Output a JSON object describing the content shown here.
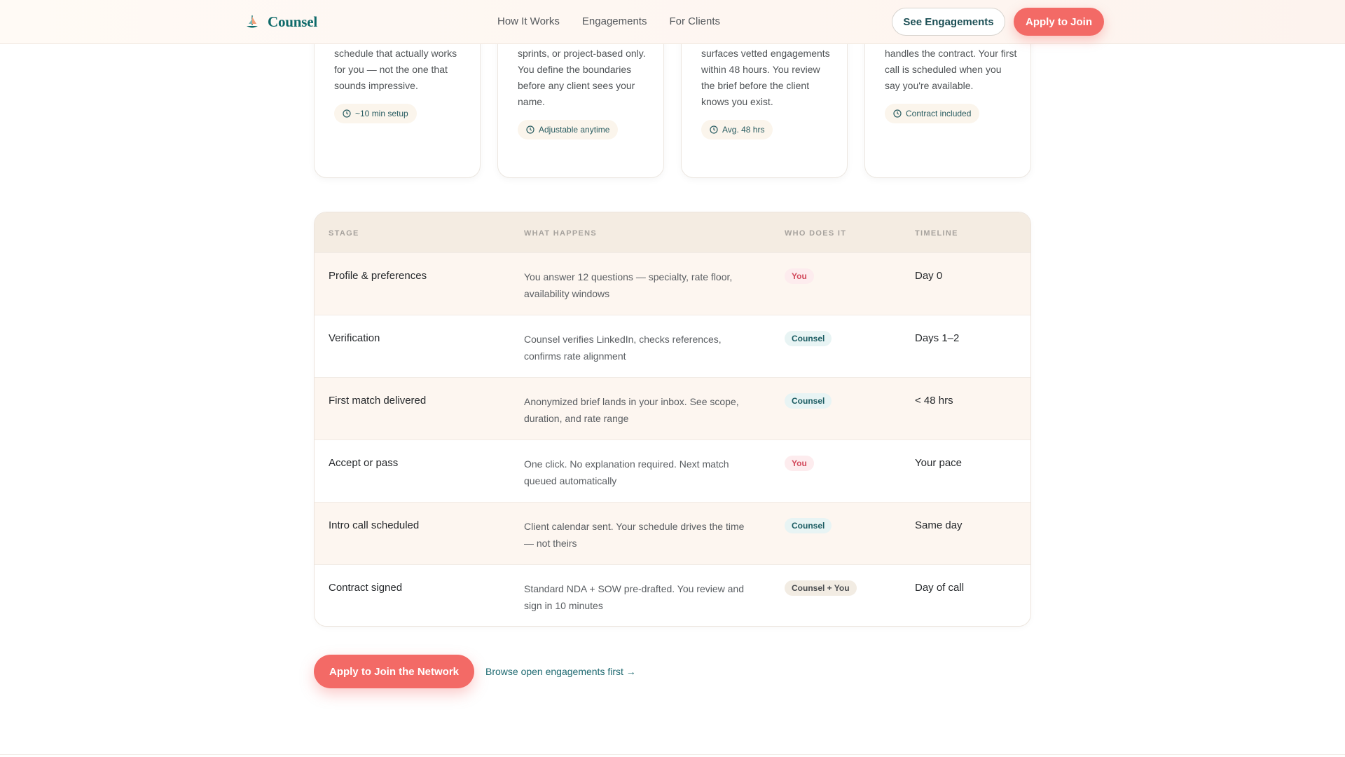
{
  "header": {
    "brand": "Counsel",
    "nav": [
      "How It Works",
      "Engagements",
      "For Clients"
    ],
    "see_engagements": "See Engagements",
    "apply": "Apply to Join"
  },
  "cards": [
    {
      "text": "schedule that actually works for you — not the one that sounds impressive.",
      "badge": "~10 min setup"
    },
    {
      "text": "sprints, or project-based only. You define the boundaries before any client sees your name.",
      "badge": "Adjustable anytime"
    },
    {
      "text": "surfaces vetted engagements within 48 hours. You review the brief before the client knows you exist.",
      "badge": "Avg. 48 hrs"
    },
    {
      "text": "handles the contract. Your first call is scheduled when you say you're available.",
      "badge": "Contract included"
    }
  ],
  "table": {
    "headers": [
      "STAGE",
      "WHAT HAPPENS",
      "WHO DOES IT",
      "TIMELINE"
    ],
    "rows": [
      {
        "stage": "Profile & preferences",
        "what": "You answer 12 questions — specialty, rate floor, availability windows",
        "who": "You",
        "timeline": "Day 0"
      },
      {
        "stage": "Verification",
        "what": "Counsel verifies LinkedIn, checks references, confirms rate alignment",
        "who": "Counsel",
        "timeline": "Days 1–2"
      },
      {
        "stage": "First match delivered",
        "what": "Anonymized brief lands in your inbox. See scope, duration, and rate range",
        "who": "Counsel",
        "timeline": "< 48 hrs"
      },
      {
        "stage": "Accept or pass",
        "what": "One click. No explanation required. Next match queued automatically",
        "who": "You",
        "timeline": "Your pace"
      },
      {
        "stage": "Intro call scheduled",
        "what": "Client calendar sent. Your schedule drives the time — not theirs",
        "who": "Counsel",
        "timeline": "Same day"
      },
      {
        "stage": "Contract signed",
        "what": "Standard NDA + SOW pre-drafted. You review and sign in 10 minutes",
        "who": "Counsel + You",
        "timeline": "Day of call"
      }
    ]
  },
  "cta": {
    "apply_network": "Apply to Join the Network",
    "browse": "Browse open engagements first →"
  }
}
